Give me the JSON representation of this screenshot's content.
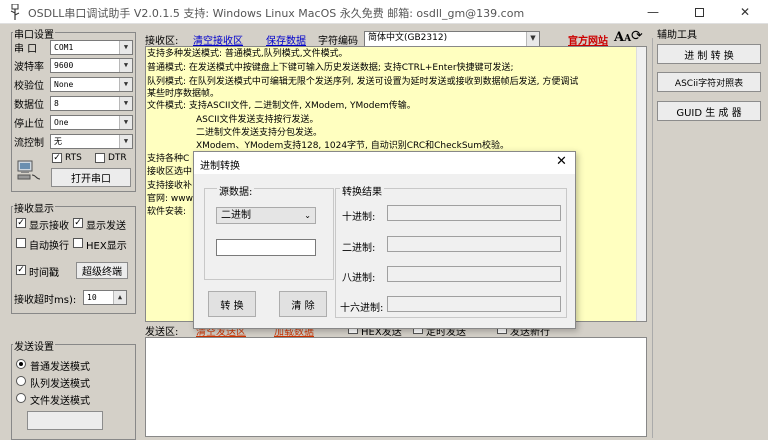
{
  "window": {
    "title": "OSDLL串口调试助手 V2.0.1.5 支持: Windows  Linux  MacOS   永久免费   邮箱: osdll_gm@139.com"
  },
  "serial_settings": {
    "title": "串口设置",
    "port_label": "串  口",
    "port_value": "COM1",
    "baud_label": "波特率",
    "baud_value": "9600",
    "parity_label": "校验位",
    "parity_value": "None",
    "databits_label": "数据位",
    "databits_value": "8",
    "stopbits_label": "停止位",
    "stopbits_value": "One",
    "flow_label": "流控制",
    "flow_value": "无",
    "rts_label": "RTS",
    "dtr_label": "DTR",
    "open_button": "打开串口"
  },
  "recv_display": {
    "title": "接收显示",
    "show_recv": "显示接收",
    "show_send": "显示发送",
    "auto_newline": "自动换行",
    "hex_display": "HEX显示",
    "timestamp": "时间戳",
    "super_terminal": "超级终端",
    "timeout_label": "接收超时ms):",
    "timeout_value": "10"
  },
  "send_settings": {
    "title": "发送设置",
    "normal": "普通发送模式",
    "queue": "队列发送模式",
    "file": "文件发送模式"
  },
  "recv_toolbar": {
    "label": "接收区:",
    "clear": "清空接收区",
    "save": "保存数据",
    "encoding_label": "字符编码",
    "encoding_value": "简体中文(GB2312)",
    "website": "官方网站",
    "font_icon": "font-size-icon"
  },
  "recv_lines": [
    "支持多种发送模式: 普通模式,队列模式,文件模式。",
    "普通模式: 在发送模式中按键盘上下键可输入历史发送数据; 支持CTRL+Enter快捷键可发送;",
    "队列模式: 在队列发送模式中可编辑无限个发送序列, 发送可设置为延时发送或接收到数据帧后发送, 方便调试",
    "某些时序数据帧。",
    "文件模式: 支持ASCII文件, 二进制文件, XModem, YModem传输。",
    "ASCII文件发送支持按行发送。",
    "二进制文件发送支持分包发送。",
    "XModem、YModem支持128, 1024字节, 自动识别CRC和CheckSum校验。",
    "支持各种C",
    "接收区选中",
    "支持接收补",
    "官网: www",
    "软件安装:"
  ],
  "send_toolbar": {
    "label": "发送区:",
    "item1": "清空发送区",
    "item2": "加载数据",
    "item3": "HEX发送",
    "item4": "定时发送",
    "item5": "发送新行"
  },
  "right_panel": {
    "title": "辅助工具",
    "btn_convert": "进 制 转 换",
    "btn_ascii": "ASCii字符对照表",
    "btn_guid": "GUID 生 成 器"
  },
  "dialog": {
    "title": "进制转换",
    "source_label": "源数据:",
    "source_type": "二进制",
    "source_input": "",
    "convert_button": "转 换",
    "clear_button": "清 除",
    "result_label": "转换结果",
    "decimal_label": "十进制:",
    "binary_label": "二进制:",
    "octal_label": "八进制:",
    "hex_label": "十六进制:"
  },
  "colors": {
    "recv_bg": "#ffffc0",
    "link": "#0000cc",
    "website": "#cc0000",
    "window_bg": "#d4d0c8"
  }
}
